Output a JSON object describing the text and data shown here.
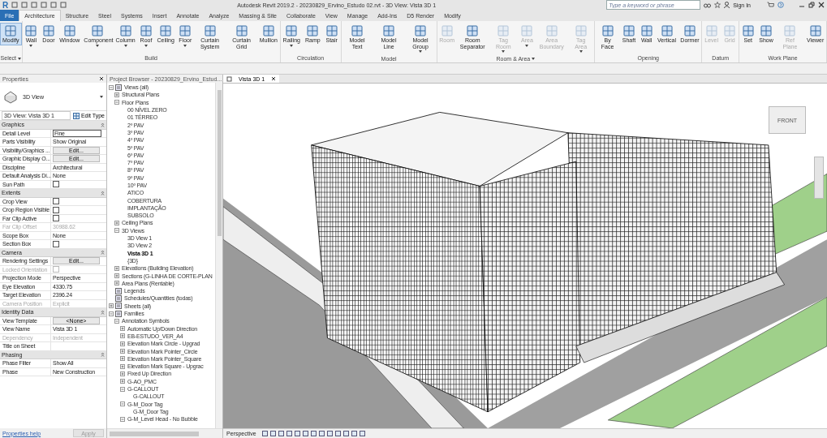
{
  "window": {
    "logo": "R",
    "title": "Autodesk Revit 2019.2 - 20230829_Ervino_Estudo 02.rvt - 3D View: Vista 3D 1",
    "search": {
      "placeholder": "Type a keyword or phrase"
    },
    "sign_in": "Sign In"
  },
  "tabs": [
    {
      "label": "File",
      "kind": "file",
      "selected": false
    },
    {
      "label": "Architecture",
      "selected": true
    },
    {
      "label": "Structure",
      "selected": false
    },
    {
      "label": "Steel",
      "selected": false
    },
    {
      "label": "Systems",
      "selected": false
    },
    {
      "label": "Insert",
      "selected": false
    },
    {
      "label": "Annotate",
      "selected": false
    },
    {
      "label": "Analyze",
      "selected": false
    },
    {
      "label": "Massing & Site",
      "selected": false
    },
    {
      "label": "Collaborate",
      "selected": false
    },
    {
      "label": "View",
      "selected": false
    },
    {
      "label": "Manage",
      "selected": false
    },
    {
      "label": "Add-Ins",
      "selected": false
    },
    {
      "label": "D5 Render",
      "selected": false
    },
    {
      "label": "Modify",
      "selected": false
    }
  ],
  "ribbon": [
    {
      "label": "Select",
      "dropdown": true,
      "tools": [
        {
          "label": "Modify",
          "selected": true,
          "disabled": false
        }
      ]
    },
    {
      "label": "Build",
      "tools": [
        {
          "label": "Wall",
          "dropdown": true,
          "disabled": false
        },
        {
          "label": "Door",
          "disabled": false
        },
        {
          "label": "Window",
          "disabled": false
        },
        {
          "label": "Component",
          "dropdown": true,
          "disabled": false
        },
        {
          "label": "Column",
          "dropdown": true,
          "disabled": false
        },
        {
          "label": "Roof",
          "dropdown": true,
          "disabled": false
        },
        {
          "label": "Ceiling",
          "disabled": false
        },
        {
          "label": "Floor",
          "dropdown": true,
          "disabled": false
        },
        {
          "label": "Curtain System",
          "disabled": false
        },
        {
          "label": "Curtain Grid",
          "disabled": false
        },
        {
          "label": "Mullion",
          "disabled": false
        }
      ]
    },
    {
      "label": "Circulation",
      "tools": [
        {
          "label": "Railing",
          "dropdown": true,
          "disabled": false
        },
        {
          "label": "Ramp",
          "disabled": false
        },
        {
          "label": "Stair",
          "disabled": false
        }
      ]
    },
    {
      "label": "Model",
      "tools": [
        {
          "label": "Model Text",
          "disabled": false
        },
        {
          "label": "Model Line",
          "disabled": false
        },
        {
          "label": "Model Group",
          "dropdown": true,
          "disabled": false
        }
      ]
    },
    {
      "label": "Room & Area",
      "dropdown": true,
      "tools": [
        {
          "label": "Room",
          "disabled": true
        },
        {
          "label": "Room Separator",
          "disabled": false
        },
        {
          "label": "Tag Room",
          "dropdown": true,
          "disabled": true
        },
        {
          "label": "Area",
          "dropdown": true,
          "disabled": true
        },
        {
          "label": "Area Boundary",
          "disabled": true
        },
        {
          "label": "Tag Area",
          "dropdown": true,
          "disabled": true
        }
      ]
    },
    {
      "label": "Opening",
      "tools": [
        {
          "label": "By Face",
          "disabled": false
        },
        {
          "label": "Shaft",
          "disabled": false
        },
        {
          "label": "Wall",
          "disabled": false
        },
        {
          "label": "Vertical",
          "disabled": false
        },
        {
          "label": "Dormer",
          "disabled": false
        }
      ]
    },
    {
      "label": "Datum",
      "tools": [
        {
          "label": "Level",
          "disabled": true
        },
        {
          "label": "Grid",
          "disabled": true
        }
      ]
    },
    {
      "label": "Work Plane",
      "tools": [
        {
          "label": "Set",
          "disabled": false
        },
        {
          "label": "Show",
          "disabled": false
        },
        {
          "label": "Ref Plane",
          "disabled": true
        },
        {
          "label": "Viewer",
          "disabled": false
        }
      ]
    }
  ],
  "properties": {
    "title": "Properties",
    "type_name": "3D View",
    "instance": "3D View: Vista 3D 1",
    "edit_type": "Edit Type",
    "groups": [
      {
        "name": "Graphics",
        "rows": [
          {
            "name": "Detail Level",
            "kind": "field",
            "value": "Fine"
          },
          {
            "name": "Parts Visibility",
            "kind": "text",
            "value": "Show Original"
          },
          {
            "name": "Visibility/Graphics ...",
            "kind": "button",
            "value": "Edit..."
          },
          {
            "name": "Graphic Display O...",
            "kind": "button",
            "value": "Edit..."
          },
          {
            "name": "Discipline",
            "kind": "text",
            "value": "Architectural"
          },
          {
            "name": "Default Analysis Di...",
            "kind": "text",
            "value": "None"
          },
          {
            "name": "Sun Path",
            "kind": "checkbox",
            "checked": false,
            "disabled": false
          }
        ]
      },
      {
        "name": "Extents",
        "rows": [
          {
            "name": "Crop View",
            "kind": "checkbox",
            "checked": false,
            "disabled": false
          },
          {
            "name": "Crop Region Visible",
            "kind": "checkbox",
            "checked": false,
            "disabled": false
          },
          {
            "name": "Far Clip Active",
            "kind": "checkbox",
            "checked": false,
            "disabled": false
          },
          {
            "name": "Far Clip Offset",
            "kind": "text",
            "value": "30988.62",
            "disabled": true
          },
          {
            "name": "Scope Box",
            "kind": "text",
            "value": "None"
          },
          {
            "name": "Section Box",
            "kind": "checkbox",
            "checked": false,
            "disabled": false
          }
        ]
      },
      {
        "name": "Camera",
        "rows": [
          {
            "name": "Rendering Settings",
            "kind": "button",
            "value": "Edit..."
          },
          {
            "name": "Locked Orientation",
            "kind": "checkbox",
            "checked": false,
            "disabled": true
          },
          {
            "name": "Projection Mode",
            "kind": "text",
            "value": "Perspective"
          },
          {
            "name": "Eye Elevation",
            "kind": "text",
            "value": "4330.75"
          },
          {
            "name": "Target Elevation",
            "kind": "text",
            "value": "2396.24"
          },
          {
            "name": "Camera Position",
            "kind": "text",
            "value": "Explicit",
            "disabled": true
          }
        ]
      },
      {
        "name": "Identity Data",
        "rows": [
          {
            "name": "View Template",
            "kind": "button",
            "value": "<None>"
          },
          {
            "name": "View Name",
            "kind": "text",
            "value": "Vista 3D 1"
          },
          {
            "name": "Dependency",
            "kind": "text",
            "value": "Independent",
            "disabled": true
          },
          {
            "name": "Title on Sheet",
            "kind": "text"
          }
        ]
      },
      {
        "name": "Phasing",
        "rows": [
          {
            "name": "Phase Filter",
            "kind": "text",
            "value": "Show All"
          },
          {
            "name": "Phase",
            "kind": "text",
            "value": "New Construction"
          }
        ]
      }
    ],
    "help_link": "Properties help",
    "apply": {
      "label": "Apply",
      "disabled": true
    }
  },
  "project_browser": {
    "title": "Project Browser - 20230829_Ervino_Estud...",
    "tree": [
      {
        "label": "Views (all)",
        "expanded": true,
        "children": [
          {
            "label": "Structural Plans",
            "expanded": false
          },
          {
            "label": "Floor Plans",
            "expanded": true,
            "children": [
              {
                "label": "00 NÍVEL ZERO"
              },
              {
                "label": "01 TÉRREO"
              },
              {
                "label": "2º PAV"
              },
              {
                "label": "3º PAV"
              },
              {
                "label": "4º PAV"
              },
              {
                "label": "5º PAV"
              },
              {
                "label": "6º PAV"
              },
              {
                "label": "7º PAV"
              },
              {
                "label": "8º PAV"
              },
              {
                "label": "9º PAV"
              },
              {
                "label": "10º PAV"
              },
              {
                "label": "ATICO"
              },
              {
                "label": "COBERTURA"
              },
              {
                "label": "IMPLANTAÇÃO"
              },
              {
                "label": "SUBSOLO"
              }
            ]
          },
          {
            "label": "Ceiling Plans",
            "expanded": false
          },
          {
            "label": "3D Views",
            "expanded": true,
            "children": [
              {
                "label": "3D View 1",
                "selected": false
              },
              {
                "label": "3D View 2",
                "selected": false
              },
              {
                "label": "Vista 3D 1",
                "selected": true
              },
              {
                "label": "{3D}",
                "selected": false
              }
            ]
          },
          {
            "label": "Elevations (Building Elevation)",
            "expanded": false
          },
          {
            "label": "Sections (G-LINHA DE CORTE-PLAN",
            "expanded": false
          },
          {
            "label": "Area Plans (Rentable)",
            "expanded": false
          }
        ]
      },
      {
        "label": "Legends"
      },
      {
        "label": "Schedules/Quantities (todas)"
      },
      {
        "label": "Sheets (all)",
        "expanded": false
      },
      {
        "label": "Families",
        "expanded": true,
        "children": [
          {
            "label": "Annotation Symbols",
            "expanded": true,
            "children": [
              {
                "label": "Automatic Up/Down Direction",
                "expanded": false
              },
              {
                "label": "EB-ESTUDO_VER_A4",
                "expanded": false
              },
              {
                "label": "Elevation Mark Circle - Upgrad",
                "expanded": false
              },
              {
                "label": "Elevation Mark Pointer_Circle",
                "expanded": false
              },
              {
                "label": "Elevation Mark Pointer_Square",
                "expanded": false
              },
              {
                "label": "Elevation Mark Square - Upgrac",
                "expanded": false
              },
              {
                "label": "Fixed Up Direction",
                "expanded": false
              },
              {
                "label": "G-AO_PMC",
                "expanded": false
              },
              {
                "label": "G-CALLOUT",
                "expanded": true,
                "children": [
                  {
                    "label": "G-CALLOUT"
                  }
                ]
              },
              {
                "label": "G-M_Door Tag",
                "expanded": true,
                "children": [
                  {
                    "label": "G-M_Door Tag"
                  }
                ]
              },
              {
                "label": "G-M_Level Head - No Bubble",
                "expanded": true
              }
            ]
          }
        ]
      }
    ]
  },
  "view": {
    "tab": "Vista 3D 1",
    "viewcube": "FRONT",
    "status": "Perspective"
  }
}
